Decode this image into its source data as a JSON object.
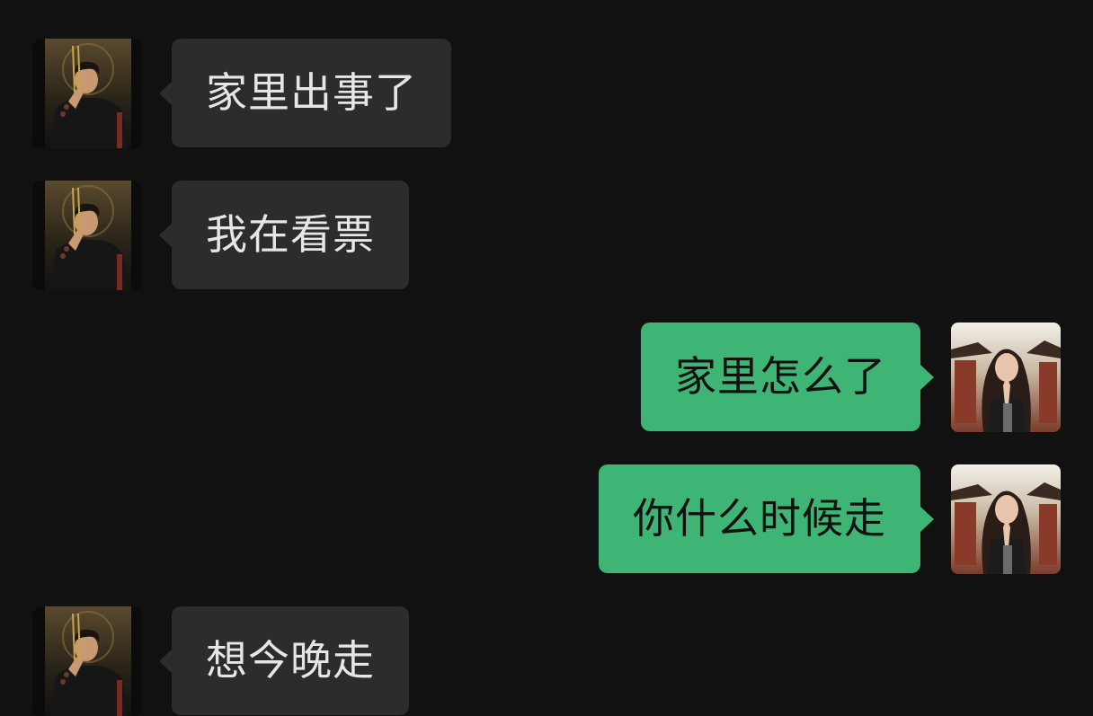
{
  "chat": {
    "messages": [
      {
        "side": "left",
        "text": "家里出事了",
        "avatar": "male-avatar"
      },
      {
        "side": "left",
        "text": "我在看票",
        "avatar": "male-avatar"
      },
      {
        "side": "right",
        "text": "家里怎么了",
        "avatar": "female-avatar"
      },
      {
        "side": "right",
        "text": "你什么时候走",
        "avatar": "female-avatar"
      },
      {
        "side": "left",
        "text": "想今晚走",
        "avatar": "male-avatar"
      }
    ]
  },
  "colors": {
    "background": "#111111",
    "incoming_bubble": "#2c2c2c",
    "outgoing_bubble": "#3eb574",
    "incoming_text": "#e6e6e6",
    "outgoing_text": "#111111"
  }
}
